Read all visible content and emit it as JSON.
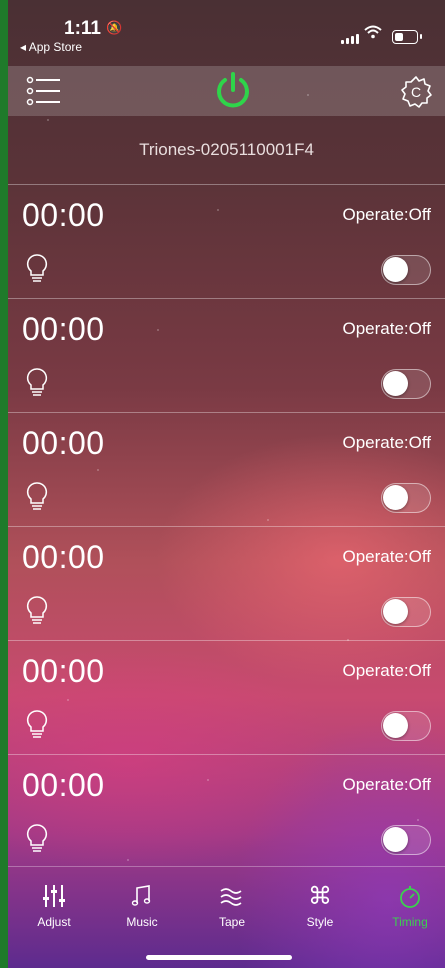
{
  "status": {
    "time": "1:11",
    "back_label": "◂ App Store"
  },
  "header": {
    "device_name": "Triones-0205110001F4"
  },
  "timers": [
    {
      "time": "00:00",
      "operate": "Operate:Off",
      "enabled": false
    },
    {
      "time": "00:00",
      "operate": "Operate:Off",
      "enabled": false
    },
    {
      "time": "00:00",
      "operate": "Operate:Off",
      "enabled": false
    },
    {
      "time": "00:00",
      "operate": "Operate:Off",
      "enabled": false
    },
    {
      "time": "00:00",
      "operate": "Operate:Off",
      "enabled": false
    },
    {
      "time": "00:00",
      "operate": "Operate:Off",
      "enabled": false
    }
  ],
  "tabs": [
    {
      "label": "Adjust",
      "icon": "sliders-icon"
    },
    {
      "label": "Music",
      "icon": "music-note-icon"
    },
    {
      "label": "Tape",
      "icon": "waves-icon"
    },
    {
      "label": "Style",
      "icon": "command-icon"
    },
    {
      "label": "Timing",
      "icon": "stopwatch-icon",
      "active": true
    }
  ],
  "colors": {
    "accent": "#2fd44a",
    "active_tab": "#3bd14f"
  }
}
